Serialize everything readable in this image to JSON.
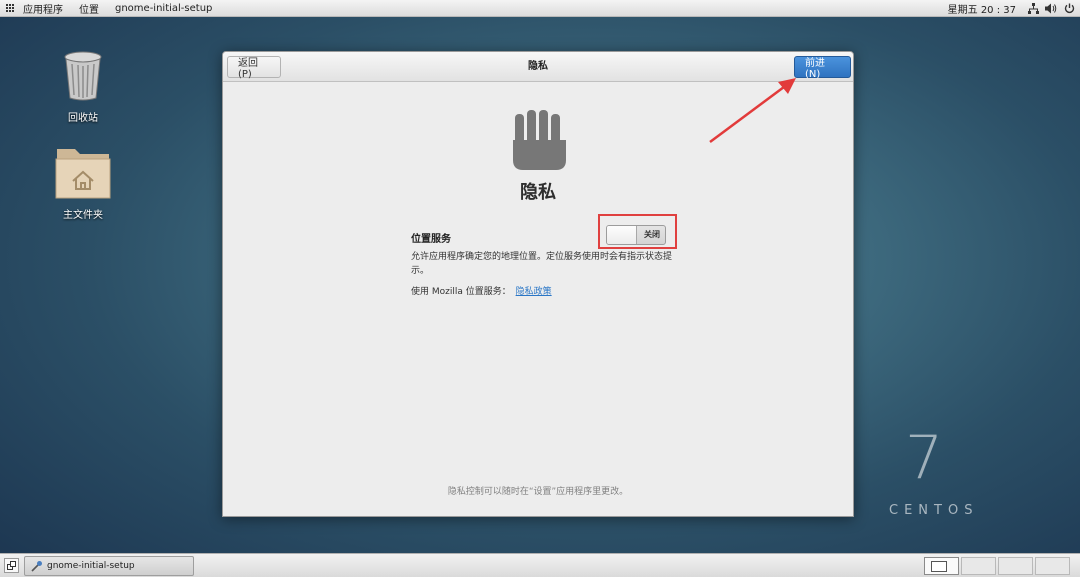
{
  "topbar": {
    "applications": "应用程序",
    "places": "位置",
    "active_app": "gnome-initial-setup",
    "clock": "星期五 20 : 37",
    "tray_icons": [
      "network-icon",
      "volume-icon",
      "power-icon"
    ]
  },
  "desktop": {
    "trash_label": "回收站",
    "home_label": "主文件夹",
    "watermark_number": "7",
    "watermark_word": "CENTOS"
  },
  "window": {
    "title": "隐私",
    "back_label": "返回(P)",
    "next_label": "前进(N)",
    "heading": "隐私",
    "location_label": "位置服务",
    "location_switch": {
      "state_label": "关闭",
      "on": false
    },
    "description": "允许应用程序确定您的地理位置。定位服务使用时会有指示状态提示。",
    "mozilla_prefix": "使用  Mozilla 位置服务：",
    "privacy_link": "隐私政策",
    "footer_note": "隐私控制可以随时在“设置”应用程序里更改。"
  },
  "taskbar": {
    "task_label": "gnome-initial-setup",
    "workspace_count": 4
  },
  "colors": {
    "accent": "#3a80cc",
    "highlight": "#e0403f"
  }
}
